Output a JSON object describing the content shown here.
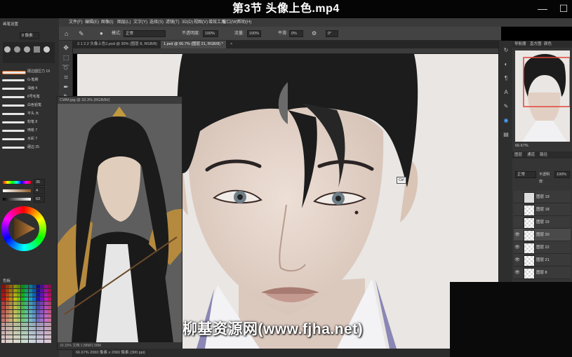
{
  "video": {
    "title": "第3节 头像上色.mp4",
    "window_buttons": [
      "—",
      "☐"
    ]
  },
  "menu": [
    "文件(F)",
    "编辑(E)",
    "图像(I)",
    "图层(L)",
    "文字(Y)",
    "选择(S)",
    "滤镜(T)",
    "3D(D)",
    "视图(V)",
    "增效工具",
    "窗口(W)",
    "帮助(H)"
  ],
  "options": {
    "mode_label": "模式:",
    "mode_value": "正常",
    "opacity_label": "不透明度:",
    "opacity_value": "100%",
    "flow_label": "流量:",
    "flow_value": "100%",
    "smooth_label": "平滑:",
    "smooth_value": "0%",
    "angle_value": "0°"
  },
  "tabs": [
    {
      "label": "2.1 2.2 头像上色1.psd @ 30% (图层 8, RGB/8)",
      "active": false
    },
    {
      "label": "1.psd @ 66.7% (图层 21, RGB/8) *",
      "active": true
    },
    {
      "label": "×",
      "active": false
    }
  ],
  "left_panel": {
    "header": "画笔设置",
    "size_value": "8 像素",
    "brushes": [
      {
        "label": "硬边圆压力 19"
      },
      {
        "label": "G-笔刷"
      },
      {
        "label": "油画 4"
      },
      {
        "label": "6号毛笔"
      },
      {
        "label": "白色铅笔"
      },
      {
        "label": "平头 大"
      },
      {
        "label": "粉笔 8"
      },
      {
        "label": "喷枪 7"
      },
      {
        "label": "水彩 7"
      },
      {
        "label": "硬边 25"
      }
    ],
    "color_values": [
      "35",
      "4",
      "63"
    ],
    "swatches_label": "色板"
  },
  "reference": {
    "title": "CWM.jpg @ 33.3% (RGB/8#)",
    "status": "33.33% 文档:1.58M/1.58M"
  },
  "cursor_label": "Ctrl",
  "status_bar": "66.67%  2060 像素 x 2060 像素 (300 ppi)",
  "right_panel": {
    "nav_tabs": [
      "导航器",
      "直方图",
      "颜色"
    ],
    "zoom": "66.67%",
    "layer_tabs": [
      "图层",
      "通道",
      "路径"
    ],
    "blend_mode": "正常",
    "opacity_label": "不透明度:",
    "opacity_value": "100%",
    "layers": [
      {
        "name": "图层 19"
      },
      {
        "name": "图层 18"
      },
      {
        "name": "图层 15"
      },
      {
        "name": "图层 20"
      },
      {
        "name": "图层 22"
      },
      {
        "name": "图层 21"
      },
      {
        "name": "图层 8"
      }
    ]
  },
  "watermark": "柳基资源网(www.fjha.net)",
  "colors": {
    "canvas_bg": "#e9e6e3",
    "hair": "#1c1c1c",
    "skin": "#e8d9cf",
    "collar": "#8a86b5"
  }
}
